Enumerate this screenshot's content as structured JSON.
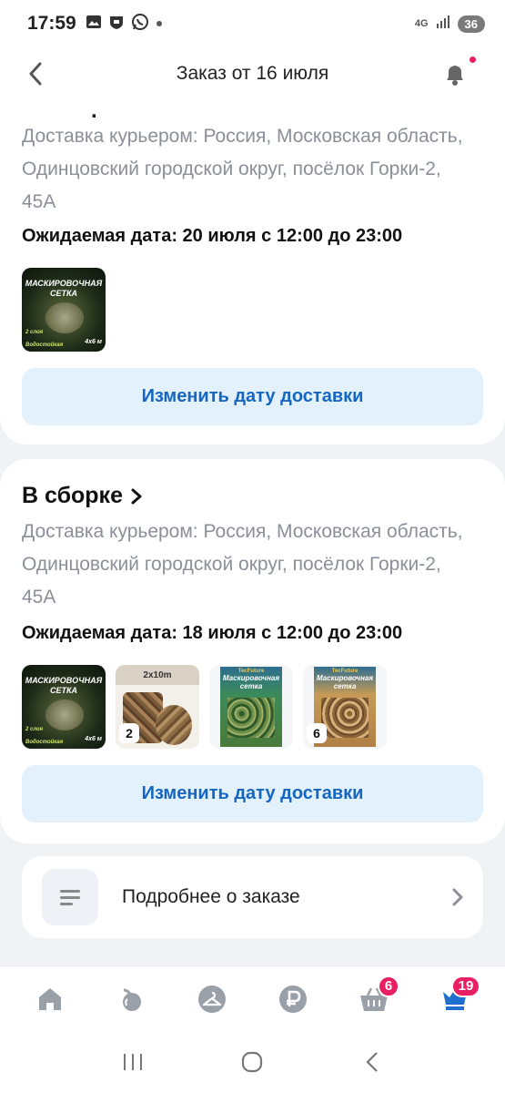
{
  "status_bar": {
    "time": "17:59",
    "network": "4G",
    "battery": "36"
  },
  "header": {
    "title": "Заказ от 16 июля"
  },
  "shipment_top": {
    "title_fragment": ".",
    "address": "Доставка курьером: Россия, Московская область, Одинцовский городской округ, посёлок Горки-2, 45А",
    "eta": "Ожидаемая дата: 20 июля с 12:00 до 23:00",
    "items": [
      {
        "name": "МАСКИРОВОЧНАЯ СЕТКА",
        "tags": [
          "2 слоя",
          "Водостойкая",
          "4х6 м"
        ]
      }
    ],
    "change_button": "Изменить дату доставки"
  },
  "shipment_assembly": {
    "status": "В сборке",
    "address": "Доставка курьером: Россия, Московская область, Одинцовский городской округ, посёлок Горки-2, 45А",
    "eta": "Ожидаемая дата: 18 июля с 12:00 до 23:00",
    "items": [
      {
        "name": "МАСКИРОВОЧНАЯ СЕТКА",
        "tags": [
          "2 слоя",
          "Водостойкая",
          "4х6 м"
        ],
        "qty": ""
      },
      {
        "name": "2x10m",
        "qty": "2"
      },
      {
        "name": "Маскировочная сетка",
        "brand": "TecFuture",
        "qty": ""
      },
      {
        "name": "Маскировочная сетка",
        "brand": "TecFuture",
        "qty": "6"
      }
    ],
    "change_button": "Изменить дату доставки"
  },
  "details": {
    "label": "Подробнее о заказе"
  },
  "bottom_nav": {
    "items": [
      {
        "icon": "home-icon"
      },
      {
        "icon": "catalog-icon"
      },
      {
        "icon": "hanger-icon"
      },
      {
        "icon": "ruble-icon"
      },
      {
        "icon": "cart-icon",
        "badge": "6"
      },
      {
        "icon": "profile-crown-icon",
        "badge": "19"
      }
    ]
  },
  "colors": {
    "accent": "#1566c0",
    "badge": "#e91e63",
    "button_bg": "#e3f1fc",
    "nav_active": "#1f6fd1"
  }
}
